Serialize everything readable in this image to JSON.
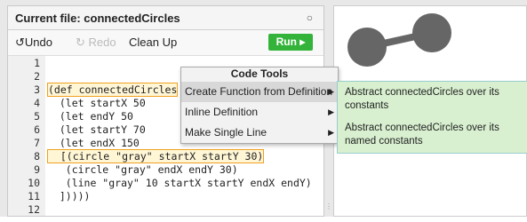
{
  "header": {
    "title": "Current file: connectedCircles",
    "toggle_glyph": "○"
  },
  "toolbar": {
    "undo": "Undo",
    "redo": "Redo",
    "cleanup": "Clean Up",
    "run": "Run"
  },
  "icons": {
    "undo": "undo-icon",
    "redo": "redo-icon",
    "run_arrow": "play-arrow-icon"
  },
  "code": {
    "line_numbers": [
      "1",
      "2",
      "3",
      "4",
      "5",
      "6",
      "7",
      "8",
      "9",
      "10",
      "11",
      "12"
    ],
    "lines": [
      "",
      "",
      "(def connectedCircles",
      "  (let startX 50",
      "  (let endY 50",
      "  (let startY 70",
      "  (let endX 150",
      "  [(circle \"gray\" startX startY 30)",
      "   (circle \"gray\" endX endY 30)",
      "   (line \"gray\" 10 startX startY endX endY)",
      "  ]))))",
      ""
    ]
  },
  "menu": {
    "header": "Code Tools",
    "items": [
      {
        "label": "Create Function from Definition",
        "has_submenu": true,
        "active": true
      },
      {
        "label": "Inline Definition",
        "has_submenu": true,
        "active": false
      },
      {
        "label": "Make Single Line",
        "has_submenu": true,
        "active": false
      }
    ]
  },
  "submenu": {
    "items": [
      "Abstract connectedCircles over its constants",
      "Abstract connectedCircles over its named constants"
    ]
  },
  "canvas": {
    "fill_color": "#666666",
    "line_color": "#666666"
  }
}
